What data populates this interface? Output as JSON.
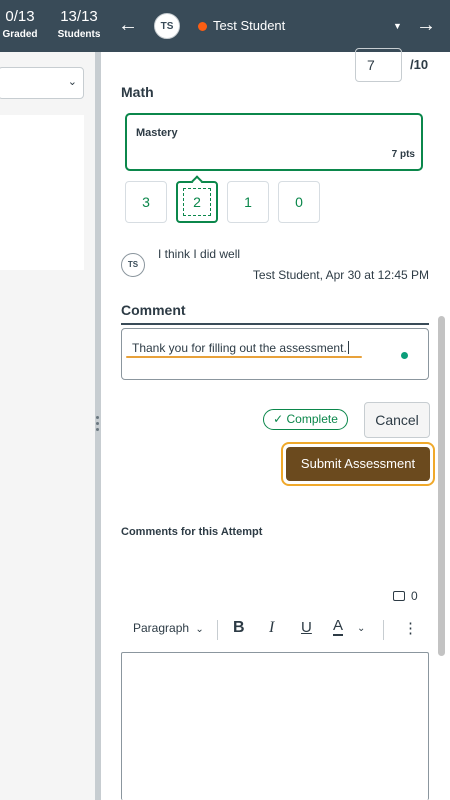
{
  "topbar": {
    "graded_count": "0/13",
    "graded_label": "Graded",
    "students_count": "13/13",
    "students_label": "Students",
    "prev_icon": "arrow-left-icon",
    "next_icon": "arrow-right-icon",
    "student_initials": "TS",
    "student_name": "Test Student",
    "status_color": "#fc5e13"
  },
  "grade": {
    "score_value": "7",
    "score_total": "/10"
  },
  "rubric": {
    "criterion": "Math",
    "selected_rating_name": "Mastery",
    "selected_rating_points": "7 pts",
    "ratings": [
      "3",
      "2",
      "1",
      "0"
    ],
    "selected_index": 1
  },
  "submission_comment": {
    "author_initials": "TS",
    "text": "I think I did well",
    "meta": "Test Student, Apr 30 at 12:45 PM"
  },
  "comment_field": {
    "label": "Comment",
    "value": "Thank you for filling out the assessment."
  },
  "actions": {
    "complete_label": "Complete",
    "cancel_label": "Cancel",
    "submit_label": "Submit Assessment"
  },
  "attempt": {
    "label": "Comments for this Attempt",
    "comment_count": "0"
  },
  "editor_toolbar": {
    "block_format": "Paragraph",
    "bold": "B",
    "italic": "I",
    "underline": "U",
    "text_color": "A",
    "more": "⋮"
  },
  "colors": {
    "topbar_bg": "#394b58",
    "accent_green": "#0b874b",
    "submit_bg": "#6b4a1e",
    "focus_ring": "#f0a92b"
  }
}
